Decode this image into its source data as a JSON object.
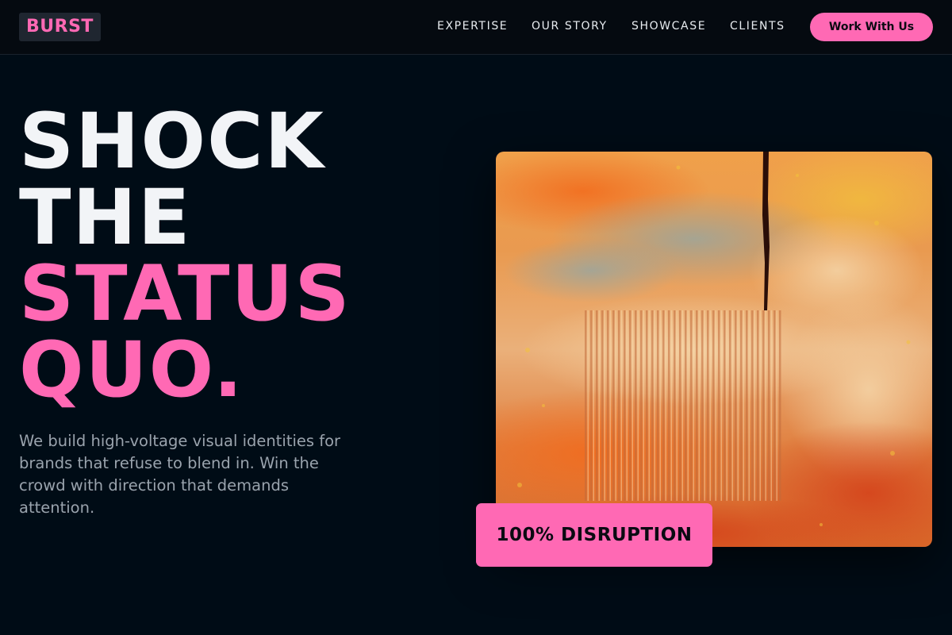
{
  "brand": {
    "logo_text": "BURST",
    "accent_color": "#ff69b4"
  },
  "nav": {
    "links": [
      "EXPERTISE",
      "OUR STORY",
      "SHOWCASE",
      "CLIENTS"
    ],
    "cta_label": "Work With Us"
  },
  "hero": {
    "headline_line1": "SHOCK",
    "headline_line2": "THE",
    "headline_line3": "STATUS",
    "headline_line4": "QUO.",
    "subtext": "We build high-voltage visual identities for brands that refuse to blend in. Win the crowd with direction that demands attention.",
    "artwork": "abstract-orange-textured-painting",
    "badge_text": "100% DISRUPTION"
  }
}
